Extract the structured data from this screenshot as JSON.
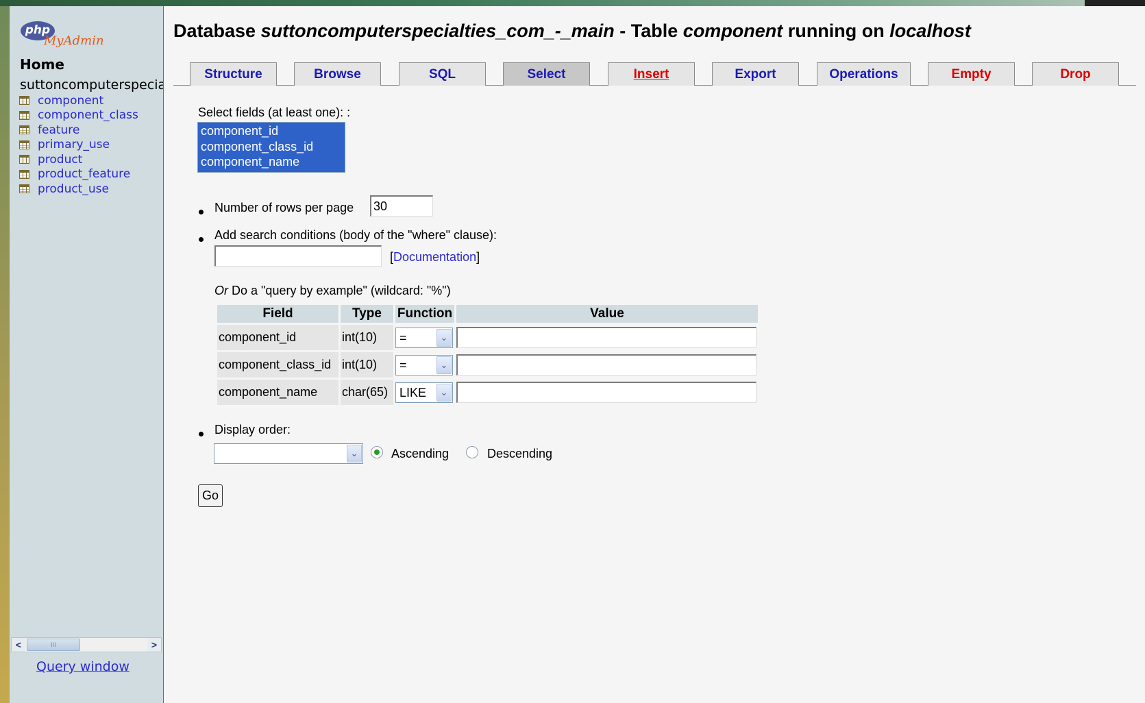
{
  "sidebar": {
    "logo_php": "php",
    "logo_myadmin": "MyAdmin",
    "home_label": "Home",
    "db_name": "suttoncomputerspecialties_com_-_main",
    "tables": [
      {
        "name": "component"
      },
      {
        "name": "component_class"
      },
      {
        "name": "feature"
      },
      {
        "name": "primary_use"
      },
      {
        "name": "product"
      },
      {
        "name": "product_feature"
      },
      {
        "name": "product_use"
      }
    ],
    "scroll_left": "<",
    "scroll_right": ">",
    "scroll_grip": "III",
    "query_window": "Query window"
  },
  "header": {
    "prefix": "Database",
    "db": "suttoncomputerspecialties_com_-_main",
    "sep": "- Table",
    "table": "component",
    "running": "running on",
    "host": "localhost"
  },
  "tabs": [
    {
      "label": "Structure",
      "color": "#1a1ab8"
    },
    {
      "label": "Browse",
      "color": "#1a1ab8"
    },
    {
      "label": "SQL",
      "color": "#1a1ab8"
    },
    {
      "label": "Select",
      "color": "#1a1ab8",
      "active": true
    },
    {
      "label": "Insert",
      "color": "#dd0000"
    },
    {
      "label": "Export",
      "color": "#1a1ab8"
    },
    {
      "label": "Operations",
      "color": "#1a1ab8"
    },
    {
      "label": "Empty",
      "color": "#dd0000"
    },
    {
      "label": "Drop",
      "color": "#dd0000"
    }
  ],
  "form": {
    "select_fields_label": "Select fields (at least one): :",
    "fields": [
      "component_id",
      "component_class_id",
      "component_name"
    ],
    "rows_per_page_label": "Number of rows per page",
    "rows_per_page_value": "30",
    "search_conditions_label": "Add search conditions (body of the \"where\" clause):",
    "search_conditions_value": "",
    "doc_open": "[",
    "doc_link": "Documentation",
    "doc_close": "]",
    "qbe_or": "Or",
    "qbe_rest": "Do a \"query by example\" (wildcard: \"%\")",
    "qbe_headers": {
      "field": "Field",
      "type": "Type",
      "function": "Function",
      "value": "Value"
    },
    "qbe_rows": [
      {
        "field": "component_id",
        "type": "int(10)",
        "function": "=",
        "value": ""
      },
      {
        "field": "component_class_id",
        "type": "int(10)",
        "function": "=",
        "value": ""
      },
      {
        "field": "component_name",
        "type": "char(65)",
        "function": "LIKE",
        "value": ""
      }
    ],
    "display_order_label": "Display order:",
    "display_order_value": "",
    "ascending_label": "Ascending",
    "descending_label": "Descending",
    "order_selected": "Ascending",
    "go_label": "Go",
    "dropdown_glyph": "⌄"
  },
  "colors": {
    "sidebar_bg": "#d0dce0",
    "link": "#2a2ad0",
    "tab_text": "#1a1ab8",
    "tab_danger": "#dd0000",
    "selection": "#2f62c9"
  }
}
